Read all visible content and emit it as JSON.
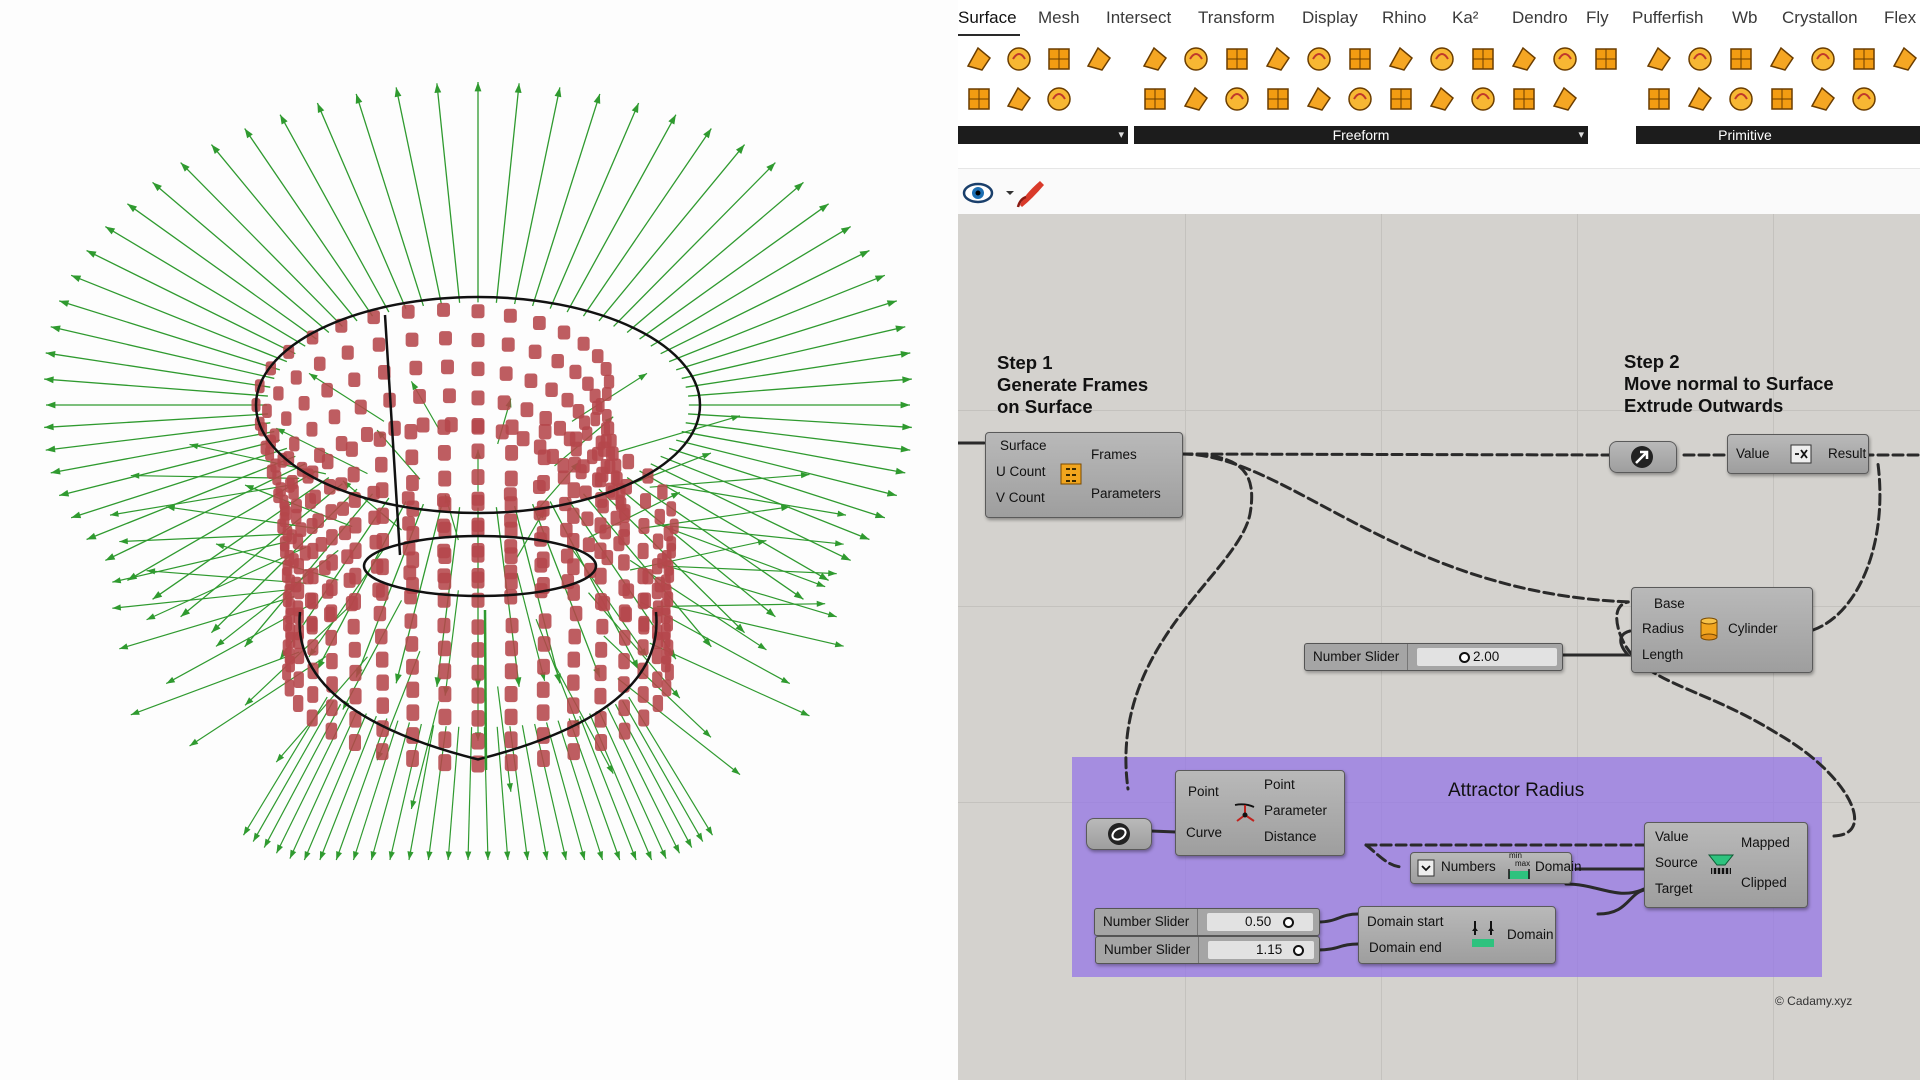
{
  "menu": {
    "tabs": [
      "Surface",
      "Mesh",
      "Intersect",
      "Transform",
      "Display",
      "Rhino",
      "Ka²",
      "Dendro",
      "Fly",
      "Pufferfish",
      "Wb",
      "Crystallon",
      "Flex"
    ],
    "active": "Surface"
  },
  "toolbar": {
    "groups": [
      {
        "label": ""
      },
      {
        "label": "Freeform"
      },
      {
        "label": "Primitive"
      }
    ]
  },
  "canvas": {
    "step1": {
      "line1": "Step 1",
      "line2": "Generate Frames",
      "line3": "on Surface"
    },
    "step2": {
      "line1": "Step 2",
      "line2": "Move normal to Surface",
      "line3": "Extrude Outwards"
    },
    "attractor_title": "Attractor Radius",
    "copyright": "© Cadamy.xyz",
    "frames_component": {
      "inputs": [
        "Surface",
        "U Count",
        "V Count"
      ],
      "outputs": [
        "Frames",
        "Parameters"
      ]
    },
    "amplitude_component": {
      "inputs": [
        "Value"
      ],
      "outputs": [
        "Result"
      ]
    },
    "cylinder_component": {
      "inputs": [
        "Base",
        "Radius",
        "Length"
      ],
      "outputs": [
        "Cylinder"
      ]
    },
    "curve_closest_component": {
      "inputs": [
        "Point",
        "Curve"
      ],
      "outputs": [
        "Point",
        "Parameter",
        "Distance"
      ]
    },
    "bounds_component": {
      "inputs": [
        "Numbers"
      ],
      "outputs": [
        "Domain"
      ],
      "icon_text_top": "min",
      "icon_text_bottom": "max"
    },
    "remap_component": {
      "inputs": [
        "Value",
        "Source",
        "Target"
      ],
      "outputs": [
        "Mapped",
        "Clipped"
      ]
    },
    "construct_domain_component": {
      "inputs": [
        "Domain start",
        "Domain end"
      ],
      "outputs": [
        "Domain"
      ]
    },
    "sliders": [
      {
        "name": "Number Slider",
        "value": "2.00",
        "fraction": 0.2
      },
      {
        "name": "Number Slider",
        "value": "0.50",
        "fraction": 0.5
      },
      {
        "name": "Number Slider",
        "value": "1.15",
        "fraction": 0.55
      }
    ]
  },
  "colors": {
    "arrow_green": "#2f9a2f",
    "box_red": "#b5474b",
    "group_purple": "#9676e6",
    "canvas_bg": "#d4d2ce"
  }
}
